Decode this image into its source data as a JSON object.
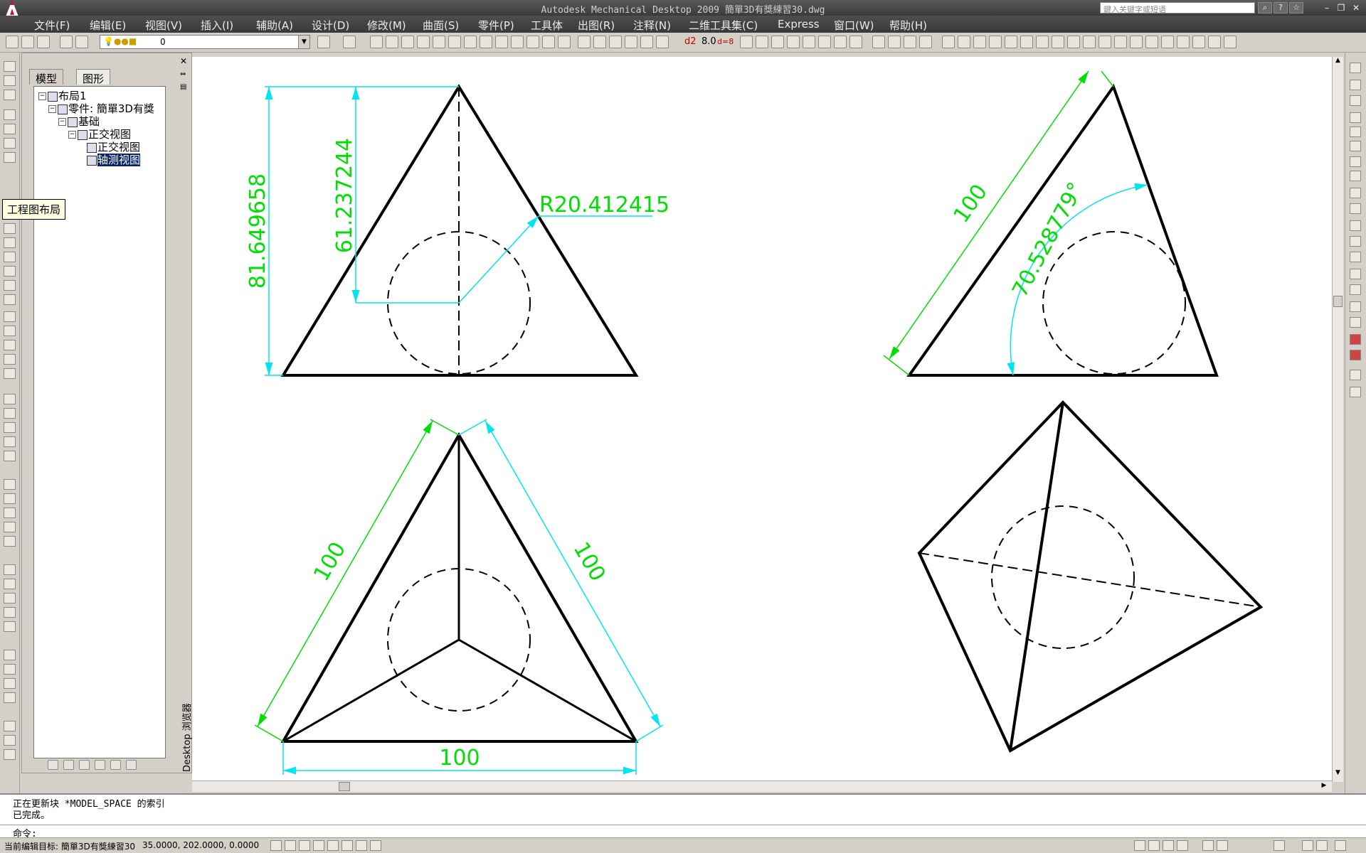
{
  "window": {
    "title": "Autodesk Mechanical Desktop 2009 簡單3D有獎練習30.dwg",
    "search_placeholder": "鍵入关键字或短语",
    "logo": "A"
  },
  "menu": [
    "文件(F)",
    "编辑(E)",
    "视图(V)",
    "插入(I)",
    "辅助(A)",
    "设计(D)",
    "修改(M)",
    "曲面(S)",
    "零件(P)",
    "工具体",
    "出图(R)",
    "注释(N)",
    "二维工具集(C)",
    "Express",
    "窗口(W)",
    "帮助(H)"
  ],
  "toolbar": {
    "layer_value": "0",
    "dim_labels": [
      "d2",
      "8.0",
      "d=8"
    ]
  },
  "browser": {
    "tabs": [
      "模型",
      "图形"
    ],
    "active_tab": "图形",
    "tree": [
      {
        "label": "布局1",
        "level": 0
      },
      {
        "label": "零件: 簡單3D有獎",
        "level": 1
      },
      {
        "label": "基础",
        "level": 2
      },
      {
        "label": "正交视图",
        "level": 3
      },
      {
        "label": "正交视图",
        "level": 4
      },
      {
        "label": "轴测视图",
        "level": 4,
        "selected": true
      }
    ],
    "tooltip": "工程图布局",
    "panel_label": "Desktop 浏览器"
  },
  "drawing": {
    "dims": {
      "height_total": "81.649658",
      "height_center": "61.237244",
      "radius": "R20.412415",
      "angle": "70.528779°",
      "edge_top_right": "100",
      "edge_left": "100",
      "edge_right": "100",
      "edge_bottom": "100"
    },
    "colors": {
      "dim_cyan": "#00e5ee",
      "dim_green": "#00e000",
      "geometry": "#000000"
    }
  },
  "command": {
    "lines": [
      "正在更新块 *MODEL_SPACE 的索引",
      "已完成。"
    ],
    "prompt": "命令:"
  },
  "status": {
    "target": "当前编辑目标: 簡單3D有獎練習30",
    "coords": "35.0000,   202.0000,  0.0000"
  }
}
